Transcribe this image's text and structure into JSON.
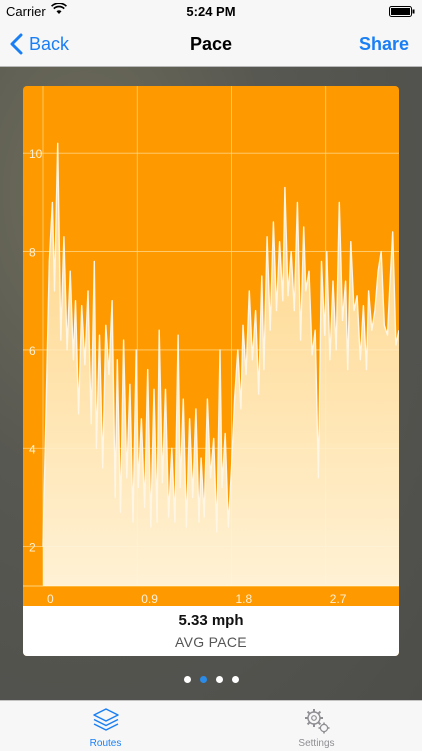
{
  "status_bar": {
    "carrier": "Carrier",
    "time": "5:24 PM"
  },
  "nav": {
    "back_label": "Back",
    "title": "Pace",
    "share_label": "Share"
  },
  "colors": {
    "card_orange": "#fe9900",
    "accent_blue": "#1a7ff5",
    "fill_light": "#fff0cc"
  },
  "chart_data": {
    "type": "area",
    "title": "",
    "xlabel": "",
    "ylabel": "",
    "xlim": [
      0,
      3.4
    ],
    "ylim": [
      1.2,
      11.0
    ],
    "xticks": [
      "0",
      "0.9",
      "1.8",
      "2.7"
    ],
    "xtick_values": [
      0,
      0.9,
      1.8,
      2.7
    ],
    "yticks": [
      "2",
      "4",
      "6",
      "8",
      "10"
    ],
    "ytick_values": [
      2,
      4,
      6,
      8,
      10
    ],
    "grid": true,
    "x": [
      0.0,
      0.03,
      0.06,
      0.09,
      0.11,
      0.14,
      0.17,
      0.2,
      0.23,
      0.26,
      0.29,
      0.31,
      0.34,
      0.37,
      0.4,
      0.43,
      0.46,
      0.49,
      0.51,
      0.54,
      0.57,
      0.6,
      0.63,
      0.66,
      0.69,
      0.71,
      0.74,
      0.77,
      0.8,
      0.83,
      0.86,
      0.89,
      0.91,
      0.94,
      0.97,
      1.0,
      1.03,
      1.06,
      1.09,
      1.11,
      1.14,
      1.17,
      1.2,
      1.23,
      1.26,
      1.29,
      1.31,
      1.34,
      1.37,
      1.4,
      1.43,
      1.46,
      1.49,
      1.51,
      1.54,
      1.57,
      1.6,
      1.63,
      1.66,
      1.69,
      1.71,
      1.74,
      1.77,
      1.8,
      1.83,
      1.86,
      1.89,
      1.91,
      1.94,
      1.97,
      2.0,
      2.03,
      2.06,
      2.09,
      2.11,
      2.14,
      2.17,
      2.2,
      2.23,
      2.26,
      2.29,
      2.31,
      2.34,
      2.37,
      2.4,
      2.43,
      2.46,
      2.49,
      2.51,
      2.54,
      2.57,
      2.6,
      2.63,
      2.66,
      2.69,
      2.71,
      2.74,
      2.77,
      2.8,
      2.83,
      2.86,
      2.89,
      2.91,
      2.94,
      2.97,
      3.0,
      3.03,
      3.06,
      3.09,
      3.11,
      3.14,
      3.17,
      3.2,
      3.23,
      3.26,
      3.29,
      3.31,
      3.34,
      3.37,
      3.4
    ],
    "values": [
      2.0,
      4.8,
      7.8,
      9.0,
      7.2,
      10.2,
      6.2,
      8.3,
      6.0,
      7.6,
      5.8,
      7.0,
      4.7,
      6.9,
      5.7,
      7.2,
      4.5,
      7.8,
      4.0,
      6.3,
      3.6,
      6.5,
      5.5,
      7.0,
      3.0,
      5.8,
      2.7,
      6.2,
      3.4,
      5.3,
      2.5,
      6.0,
      3.2,
      4.6,
      2.8,
      5.6,
      2.4,
      5.2,
      2.5,
      6.4,
      3.3,
      5.2,
      2.6,
      4.0,
      2.5,
      6.3,
      3.2,
      5.0,
      2.4,
      4.6,
      3.0,
      4.8,
      2.5,
      3.8,
      2.6,
      5.0,
      3.4,
      4.2,
      2.3,
      6.0,
      3.2,
      4.3,
      2.4,
      3.6,
      5.0,
      6.0,
      4.8,
      6.5,
      5.5,
      7.2,
      5.8,
      6.8,
      5.1,
      7.5,
      5.6,
      8.3,
      6.4,
      8.6,
      6.8,
      8.2,
      7.0,
      9.3,
      7.1,
      8.0,
      6.8,
      9.0,
      6.2,
      8.5,
      7.2,
      7.6,
      5.9,
      6.4,
      3.4,
      7.8,
      6.3,
      8.0,
      5.8,
      7.4,
      6.0,
      9.0,
      6.6,
      7.4,
      5.6,
      8.2,
      6.8,
      7.1,
      5.8,
      6.9,
      5.6,
      7.2,
      6.4,
      6.8,
      7.6,
      8.0,
      6.5,
      6.3,
      7.2,
      8.4,
      6.1,
      6.4
    ]
  },
  "stat": {
    "value": "5.33 mph",
    "label": "AVG PACE"
  },
  "pager": {
    "count": 4,
    "active": 1
  },
  "tabs": [
    {
      "label": "Routes",
      "icon": "layers-icon",
      "selected": true
    },
    {
      "label": "Settings",
      "icon": "gears-icon",
      "selected": false
    }
  ]
}
